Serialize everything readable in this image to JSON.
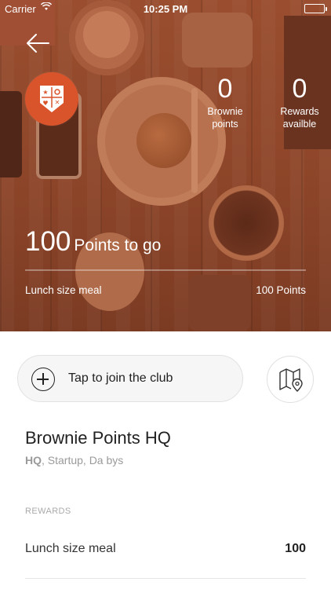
{
  "status_bar": {
    "carrier": "Carrier",
    "time": "10:25 PM"
  },
  "hero": {
    "brownie_points_value": "0",
    "brownie_points_label_line1": "Brownie",
    "brownie_points_label_line2": "points",
    "rewards_value": "0",
    "rewards_label_line1": "Rewards",
    "rewards_label_line2": "availble",
    "points_to_go_value": "100",
    "points_to_go_label": "Points to go",
    "progress_fraction": 0.0,
    "next_reward_name": "Lunch size meal",
    "next_reward_points": "100 Points"
  },
  "actions": {
    "join_label": "Tap to join the club"
  },
  "venue": {
    "name": "Brownie Points HQ",
    "category_bold": "HQ",
    "category_rest": ", Startup, Da bys"
  },
  "rewards": {
    "heading": "REWARDS",
    "items": [
      {
        "name": "Lunch size meal",
        "points": "100"
      }
    ]
  },
  "colors": {
    "badge": "#d9542a",
    "hero_tint": "#8d4529"
  },
  "icons": {
    "back": "arrow-left-icon",
    "badge": "shield-crest-icon",
    "join": "plus-circle-icon",
    "map": "map-pin-icon"
  }
}
